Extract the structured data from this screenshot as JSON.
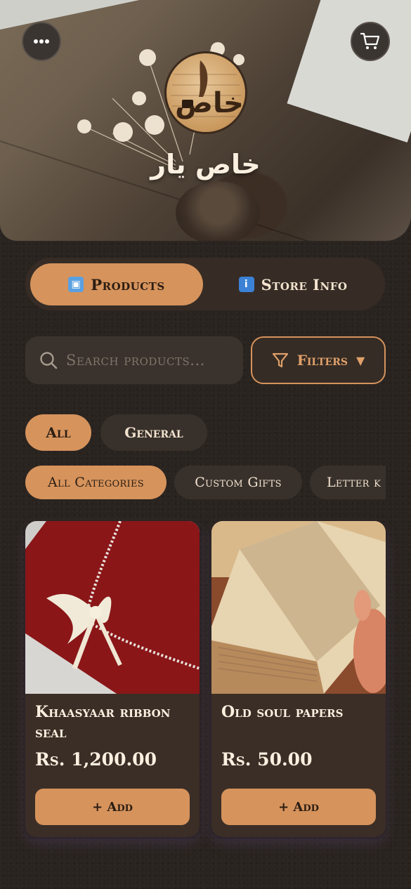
{
  "header": {
    "store_name": "خاص یار",
    "logo_text": "خاص",
    "menu_icon": "more-horizontal-icon",
    "cart_icon": "shopping-cart-icon"
  },
  "tabs": [
    {
      "label": "Products",
      "icon": "shopping-bags-emoji",
      "active": true
    },
    {
      "label": "Store Info",
      "icon": "information-emoji",
      "active": false
    }
  ],
  "search": {
    "placeholder": "Search products..."
  },
  "filters": {
    "label": "Filters",
    "arrow": "▼"
  },
  "type_chips": [
    {
      "label": "All",
      "active": true
    },
    {
      "label": "General",
      "active": false
    }
  ],
  "category_chips": [
    {
      "label": "All Categories",
      "active": true
    },
    {
      "label": "Custom Gifts",
      "active": false
    },
    {
      "label": "Letter k",
      "active": false
    }
  ],
  "products": [
    {
      "title": "Khaasyaar ribbon seal",
      "price": "Rs. 1,200.00",
      "add_label": "+ Add"
    },
    {
      "title": "Old soul papers",
      "price": "Rs. 50.00",
      "add_label": "+ Add"
    }
  ],
  "colors": {
    "accent": "#d6935c",
    "background": "#2a2420",
    "card": "#3b2e26"
  }
}
